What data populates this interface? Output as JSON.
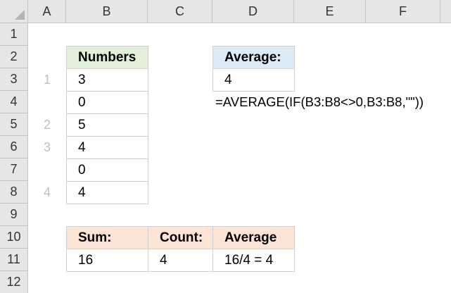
{
  "columns": [
    "A",
    "B",
    "C",
    "D",
    "E",
    "F"
  ],
  "rows": [
    "1",
    "2",
    "3",
    "4",
    "5",
    "6",
    "7",
    "8",
    "9",
    "10",
    "11",
    "12"
  ],
  "numbers_table": {
    "header": "Numbers",
    "values": [
      "3",
      "0",
      "5",
      "4",
      "0",
      "4"
    ]
  },
  "index_labels": [
    "1",
    "2",
    "3",
    "4"
  ],
  "average_box": {
    "header": "Average:",
    "value": "4",
    "formula": "=AVERAGE(IF(B3:B8<>0,B3:B8,\"\"))"
  },
  "summary_table": {
    "headers": [
      "Sum:",
      "Count:",
      "Average"
    ],
    "values": [
      "16",
      "4",
      "16/4 = 4"
    ]
  },
  "colors": {
    "header_bg": "#e6e6e6",
    "green_fill": "#e2efda",
    "blue_fill": "#ddebf7",
    "peach_fill": "#fce4d6",
    "index_text": "#bfbfbf"
  }
}
